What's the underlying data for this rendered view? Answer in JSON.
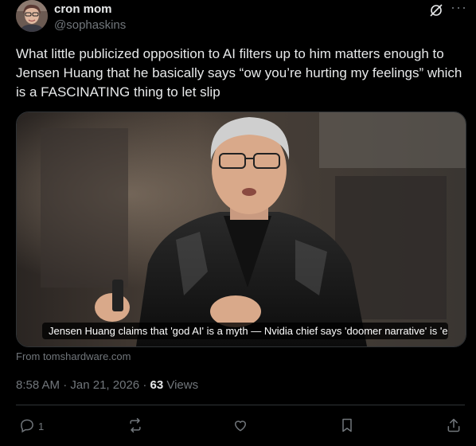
{
  "author": {
    "display_name": "cron mom",
    "handle": "@sophaskins"
  },
  "tweet": {
    "text": "What little publicized opposition to AI filters up to him matters enough to Jensen Huang that he basically says “ow you’re hurting my feelings” which is a FASCINATING thing to let slip"
  },
  "card": {
    "caption": "Jensen Huang claims that 'god AI' is a myth — Nvidia chief says 'doomer narrative' is 'e...",
    "source": "From tomshardware.com"
  },
  "meta": {
    "time": "8:58 AM",
    "separator": "·",
    "date": "Jan 21, 2026",
    "views_count": "63",
    "views_label": "Views"
  },
  "actions": {
    "reply_count": "1"
  },
  "icons": [
    "grok-icon",
    "more-icon",
    "reply-icon",
    "repost-icon",
    "like-icon",
    "bookmark-icon",
    "share-icon"
  ],
  "colors": {
    "background": "#000000",
    "text": "#e7e9ea",
    "secondary": "#71767b",
    "divider": "#2f3336"
  }
}
